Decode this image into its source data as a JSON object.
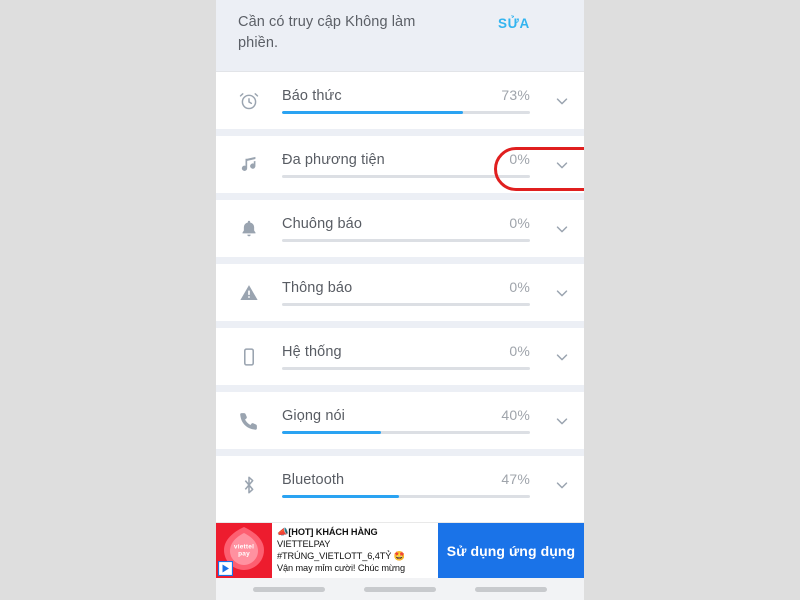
{
  "notice": {
    "message": "Cần có truy cập Không làm phiền.",
    "action_label": "SỬA"
  },
  "volume_rows": [
    {
      "icon": "alarm-clock-icon",
      "label": "Báo thức",
      "percent_label": "73%",
      "percent": 73
    },
    {
      "icon": "music-note-icon",
      "label": "Đa phương tiện",
      "percent_label": "0%",
      "percent": 0
    },
    {
      "icon": "bell-icon",
      "label": "Chuông báo",
      "percent_label": "0%",
      "percent": 0
    },
    {
      "icon": "warning-icon",
      "label": "Thông báo",
      "percent_label": "0%",
      "percent": 0
    },
    {
      "icon": "device-icon",
      "label": "Hệ thống",
      "percent_label": "0%",
      "percent": 0
    },
    {
      "icon": "phone-call-icon",
      "label": "Giọng nói",
      "percent_label": "40%",
      "percent": 40
    },
    {
      "icon": "bluetooth-icon",
      "label": "Bluetooth",
      "percent_label": "47%",
      "percent": 47
    }
  ],
  "ad": {
    "brand_line1": "viettel",
    "brand_line2": "pay",
    "text_line1": "[HOT] KHÁCH HÀNG",
    "text_line2": "VIETTELPAY",
    "text_line3": "#TRÚNG_VIETLOTT_6,4TỶ 🤩",
    "text_line4": "Vận may mỉm cười! Chúc mừng",
    "cta_label": "Sử dụng ứng dụng"
  },
  "colors": {
    "accent_blue": "#2aa3f2",
    "link_blue": "#32b4f0",
    "highlight_red": "#e01f1f",
    "arrow_orange": "#f4400c",
    "ad_red": "#ed1c2e",
    "cta_blue": "#1a73e8"
  }
}
